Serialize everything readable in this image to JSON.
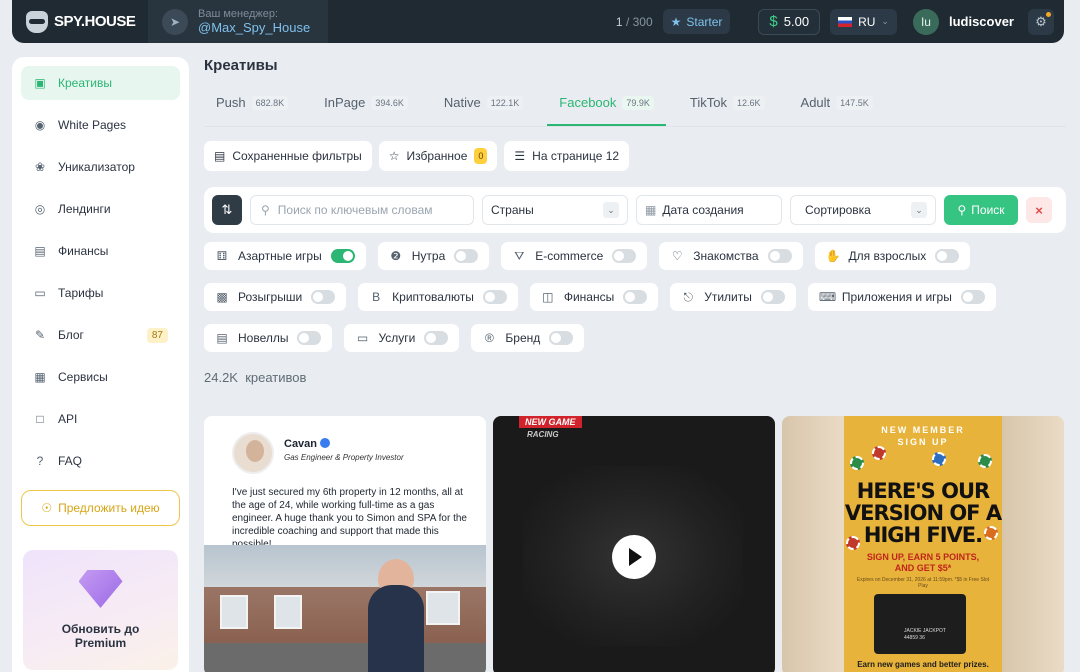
{
  "header": {
    "logo_text": "SPY.HOUSE",
    "manager_caption": "Ваш менеджер:",
    "manager_name": "@Max_Spy_House",
    "counter_used": "1",
    "counter_total": "/ 300",
    "plan": "Starter",
    "balance": "5.00",
    "language": "RU",
    "avatar_initials": "Iu",
    "username": "ludiscover"
  },
  "sidebar": {
    "items": [
      {
        "label": "Креативы",
        "icon": "creatives-icon"
      },
      {
        "label": "White Pages",
        "icon": "globe-icon"
      },
      {
        "label": "Уникализатор",
        "icon": "fingerprint-icon"
      },
      {
        "label": "Лендинги",
        "icon": "target-icon"
      },
      {
        "label": "Финансы",
        "icon": "wallet-icon"
      },
      {
        "label": "Тарифы",
        "icon": "card-icon"
      },
      {
        "label": "Блог",
        "icon": "pen-icon",
        "badge": "87"
      },
      {
        "label": "Сервисы",
        "icon": "grid-icon"
      },
      {
        "label": "API",
        "icon": "api-icon"
      },
      {
        "label": "FAQ",
        "icon": "question-icon"
      }
    ],
    "idea_button": "Предложить идею",
    "upgrade_line1": "Обновить до",
    "upgrade_line2": "Premium"
  },
  "main": {
    "title": "Креативы",
    "tabs": [
      {
        "label": "Push",
        "count": "682.8K"
      },
      {
        "label": "InPage",
        "count": "394.6K"
      },
      {
        "label": "Native",
        "count": "122.1K"
      },
      {
        "label": "Facebook",
        "count": "79.9K"
      },
      {
        "label": "TikTok",
        "count": "12.6K"
      },
      {
        "label": "Adult",
        "count": "147.5K"
      }
    ],
    "saved_filters": "Сохраненные фильтры",
    "favorites": "Избранное",
    "favorites_count": "0",
    "per_page": "На странице 12",
    "search_placeholder": "Поиск по ключевым словам",
    "countries": "Страны",
    "date_created": "Дата создания",
    "sort": "Сортировка",
    "search_button": "Поиск",
    "categories": [
      {
        "label": "Азартные игры",
        "on": true
      },
      {
        "label": "Нутра",
        "on": false
      },
      {
        "label": "E-commerce",
        "on": false
      },
      {
        "label": "Знакомства",
        "on": false
      },
      {
        "label": "Для взрослых",
        "on": false
      },
      {
        "label": "Розыгрыши",
        "on": false
      },
      {
        "label": "Криптовалюты",
        "on": false
      },
      {
        "label": "Финансы",
        "on": false
      },
      {
        "label": "Утилиты",
        "on": false
      },
      {
        "label": "Приложения и игры",
        "on": false
      },
      {
        "label": "Новеллы",
        "on": false
      },
      {
        "label": "Услуги",
        "on": false
      },
      {
        "label": "Бренд",
        "on": false
      }
    ],
    "total_count": "24.2K",
    "total_label": "креативов"
  },
  "cards": {
    "card1": {
      "name": "Cavan",
      "role": "Gas Engineer & Property Investor",
      "text": "I've just secured my 6th property in 12 months, all at the age of 24, while working full-time as a gas engineer. A huge thank you to Simon and SPA for the incredible coaching and support that made this possible!"
    },
    "card2": {
      "tag": "NEW GAME",
      "brand": "RACING"
    },
    "card3": {
      "top1": "NEW MEMBER",
      "top2": "SIGN UP",
      "headline1": "HERE'S OUR",
      "headline2": "VERSION OF A",
      "headline3": "HIGH FIVE.",
      "sub1": "SIGN UP, EARN 5 POINTS,",
      "sub2": "AND GET $5*",
      "fine": "Expires on December 31, 2026 at 11:59pm. *$5 in Free Slot Play",
      "card_text1": "JACKIE JACKPOT",
      "card_text2": "44859 36",
      "footer": "Earn new games and better prizes."
    }
  },
  "colors": {
    "accent": "#2bb673",
    "topbar": "#1f2a33",
    "danger": "#e24848",
    "badge_yellow": "#ffcf3d"
  }
}
